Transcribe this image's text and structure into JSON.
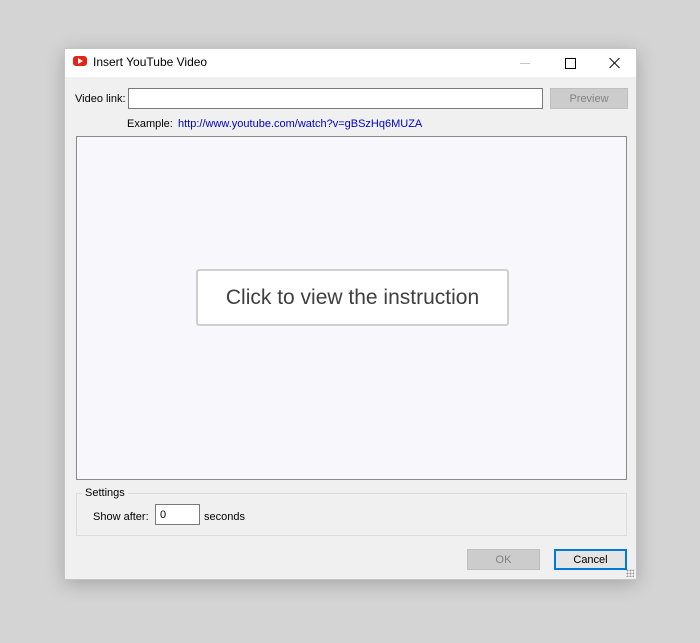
{
  "window": {
    "title": "Insert YouTube Video"
  },
  "video_link": {
    "label": "Video link:",
    "value": "",
    "placeholder": ""
  },
  "preview_button": {
    "label": "Preview",
    "enabled": false
  },
  "example": {
    "label": "Example:",
    "url": "http://www.youtube.com/watch?v=gBSzHq6MUZA"
  },
  "instruction_button": {
    "label": "Click to view the instruction"
  },
  "settings": {
    "legend": "Settings",
    "show_after_label": "Show after:",
    "show_after_value": "0",
    "seconds_label": "seconds"
  },
  "footer": {
    "ok_label": "OK",
    "cancel_label": "Cancel"
  },
  "colors": {
    "youtube_red": "#e62117",
    "link_blue": "#0000cc",
    "focus_blue": "#0078d7"
  }
}
